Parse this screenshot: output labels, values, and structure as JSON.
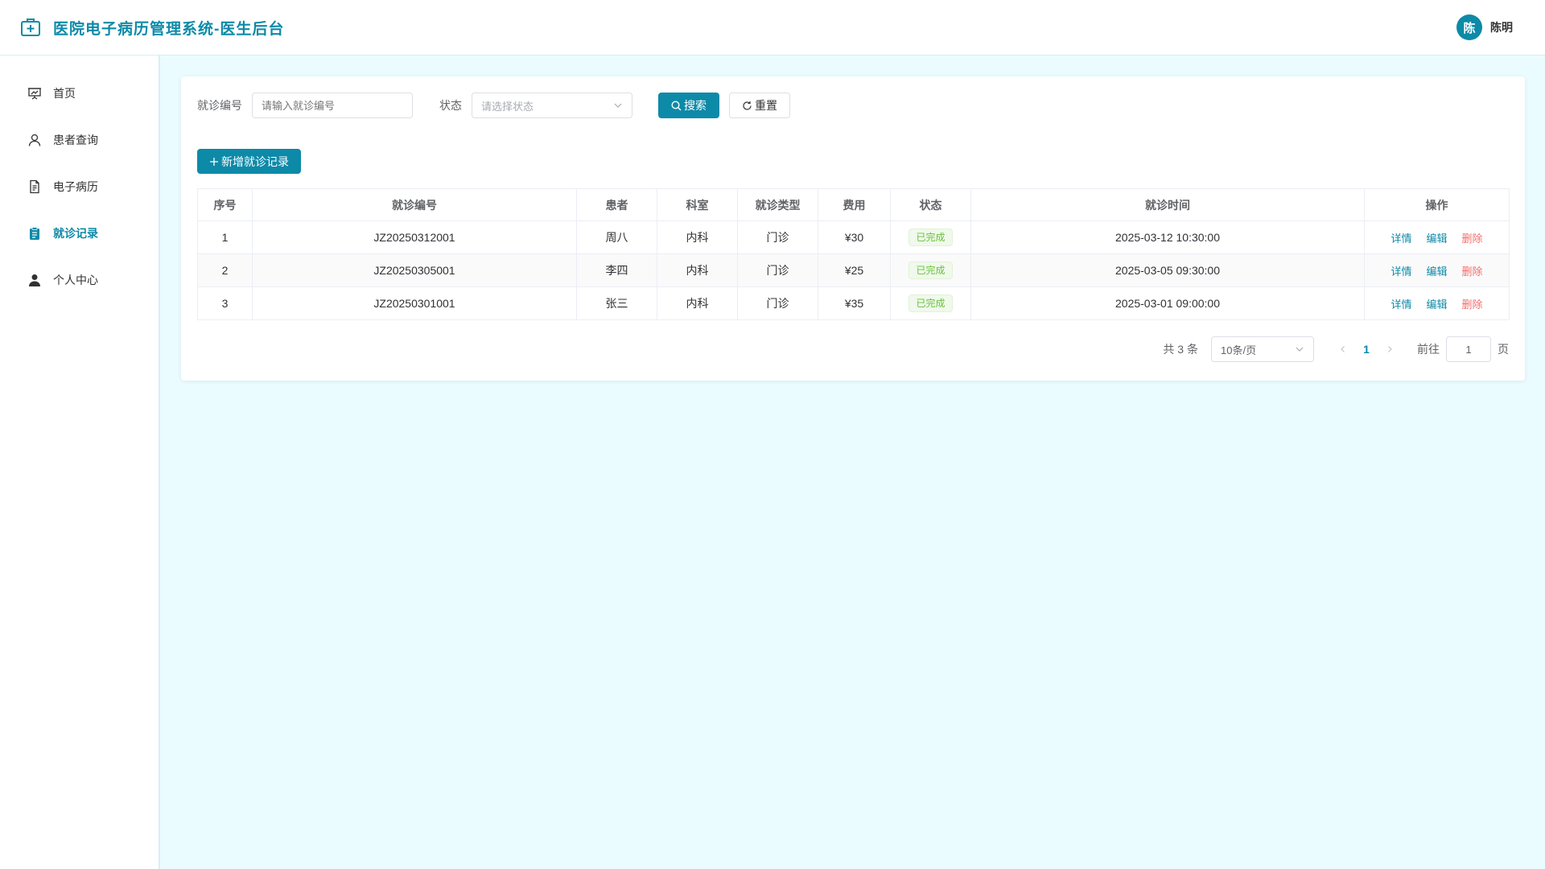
{
  "app": {
    "title": "医院电子病历管理系统-医生后台"
  },
  "user": {
    "avatar_text": "陈",
    "name": "陈明"
  },
  "sidebar": {
    "items": [
      {
        "label": "首页",
        "icon": "presentation-chart-icon"
      },
      {
        "label": "患者查询",
        "icon": "user-icon"
      },
      {
        "label": "电子病历",
        "icon": "document-icon"
      },
      {
        "label": "就诊记录",
        "icon": "clipboard-icon",
        "active": true
      },
      {
        "label": "个人中心",
        "icon": "user-filled-icon"
      }
    ]
  },
  "filters": {
    "visit_no_label": "就诊编号",
    "visit_no_placeholder": "请输入就诊编号",
    "status_label": "状态",
    "status_placeholder": "请选择状态",
    "search_label": "搜索",
    "reset_label": "重置"
  },
  "toolbar": {
    "add_label": "新增就诊记录"
  },
  "table": {
    "columns": [
      "序号",
      "就诊编号",
      "患者",
      "科室",
      "就诊类型",
      "费用",
      "状态",
      "就诊时间",
      "操作"
    ],
    "rows": [
      {
        "index": "1",
        "visit_no": "JZ20250312001",
        "patient": "周八",
        "dept": "内科",
        "type": "门诊",
        "fee": "¥30",
        "status": "已完成",
        "time": "2025-03-12 10:30:00"
      },
      {
        "index": "2",
        "visit_no": "JZ20250305001",
        "patient": "李四",
        "dept": "内科",
        "type": "门诊",
        "fee": "¥25",
        "status": "已完成",
        "time": "2025-03-05 09:30:00"
      },
      {
        "index": "3",
        "visit_no": "JZ20250301001",
        "patient": "张三",
        "dept": "内科",
        "type": "门诊",
        "fee": "¥35",
        "status": "已完成",
        "time": "2025-03-01 09:00:00"
      }
    ],
    "actions": {
      "detail": "详情",
      "edit": "编辑",
      "delete": "删除"
    }
  },
  "pagination": {
    "total_text": "共 3 条",
    "page_size": "10条/页",
    "current_page": "1",
    "goto_label": "前往",
    "goto_value": "1",
    "page_suffix": "页"
  },
  "colors": {
    "primary": "#0d8aa8",
    "danger": "#f56c6c",
    "success": "#67c23a",
    "background": "#eafcff"
  }
}
